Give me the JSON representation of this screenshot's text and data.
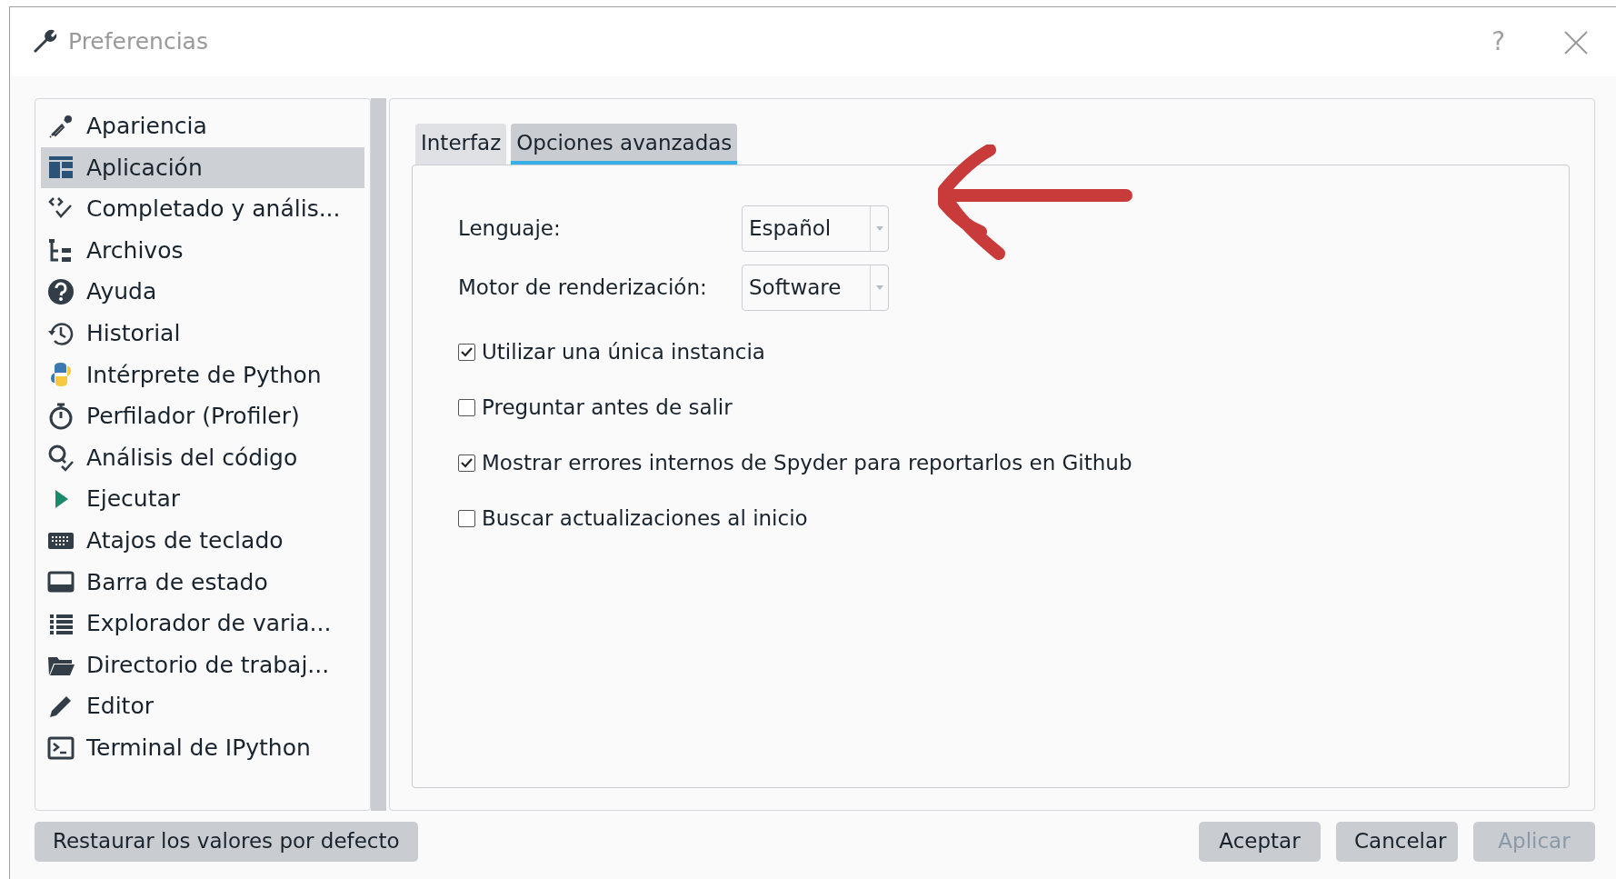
{
  "window": {
    "title": "Preferencias",
    "help": "?"
  },
  "sidebar": {
    "items": [
      {
        "label": "Apariencia",
        "selected": false
      },
      {
        "label": "Aplicación",
        "selected": true
      },
      {
        "label": "Completado y anális...",
        "selected": false
      },
      {
        "label": "Archivos",
        "selected": false
      },
      {
        "label": "Ayuda",
        "selected": false
      },
      {
        "label": "Historial",
        "selected": false
      },
      {
        "label": "Intérprete de Python",
        "selected": false
      },
      {
        "label": "Perfilador (Profiler)",
        "selected": false
      },
      {
        "label": "Análisis del código",
        "selected": false
      },
      {
        "label": "Ejecutar",
        "selected": false
      },
      {
        "label": "Atajos de teclado",
        "selected": false
      },
      {
        "label": "Barra de estado",
        "selected": false
      },
      {
        "label": "Explorador de varia...",
        "selected": false
      },
      {
        "label": "Directorio de trabaj...",
        "selected": false
      },
      {
        "label": "Editor",
        "selected": false
      },
      {
        "label": "Terminal de IPython",
        "selected": false
      }
    ]
  },
  "tabs": [
    {
      "label": "Interfaz",
      "selected": false
    },
    {
      "label": "Opciones avanzadas",
      "selected": true
    }
  ],
  "fields": [
    {
      "label": "Lenguaje:",
      "value": "Español"
    },
    {
      "label": "Motor de renderización:",
      "value": "Software"
    }
  ],
  "options": [
    {
      "label": "Utilizar una única instancia",
      "checked": true
    },
    {
      "label": "Preguntar antes de salir",
      "checked": false
    },
    {
      "label": "Mostrar errores internos de Spyder para reportarlos en Github",
      "checked": true
    },
    {
      "label": "Buscar actualizaciones al inicio",
      "checked": false
    }
  ],
  "annotation": {
    "kind": "arrow"
  },
  "buttons": {
    "reset": "Restaurar los valores por defecto",
    "actions": [
      {
        "label": "Aceptar",
        "disabled": false
      },
      {
        "label": "Cancelar",
        "disabled": false
      },
      {
        "label": "Aplicar",
        "disabled": true
      }
    ]
  }
}
